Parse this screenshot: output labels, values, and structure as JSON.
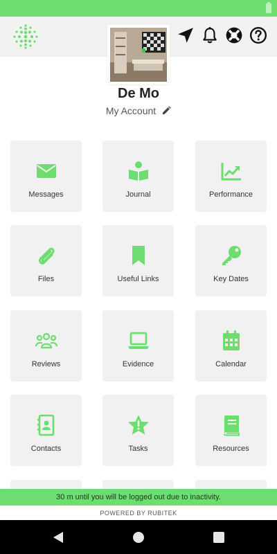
{
  "header": {
    "icons": [
      "logo-icon",
      "location-arrow-icon",
      "bell-icon",
      "lifebuoy-icon",
      "help-icon"
    ]
  },
  "profile": {
    "name": "De Mo",
    "account_label": "My Account"
  },
  "tiles": [
    {
      "label": "Messages",
      "icon": "envelope-icon"
    },
    {
      "label": "Journal",
      "icon": "book-reader-icon"
    },
    {
      "label": "Performance",
      "icon": "chart-line-icon"
    },
    {
      "label": "Files",
      "icon": "paperclip-icon"
    },
    {
      "label": "Useful Links",
      "icon": "bookmark-icon"
    },
    {
      "label": "Key Dates",
      "icon": "key-icon"
    },
    {
      "label": "Reviews",
      "icon": "users-icon"
    },
    {
      "label": "Evidence",
      "icon": "laptop-icon"
    },
    {
      "label": "Calendar",
      "icon": "calendar-icon"
    },
    {
      "label": "Contacts",
      "icon": "address-book-icon"
    },
    {
      "label": "Tasks",
      "icon": "star-exclamation-icon"
    },
    {
      "label": "Resources",
      "icon": "book-icon"
    }
  ],
  "footer": {
    "logout_notice": "30 m until you will be logged out due to inactivity.",
    "powered_by": "POWERED BY RUBITEK"
  },
  "colors": {
    "accent": "#6ddd6f",
    "tile_background": "#f1f1f1",
    "header_background": "#f2f2f2"
  }
}
